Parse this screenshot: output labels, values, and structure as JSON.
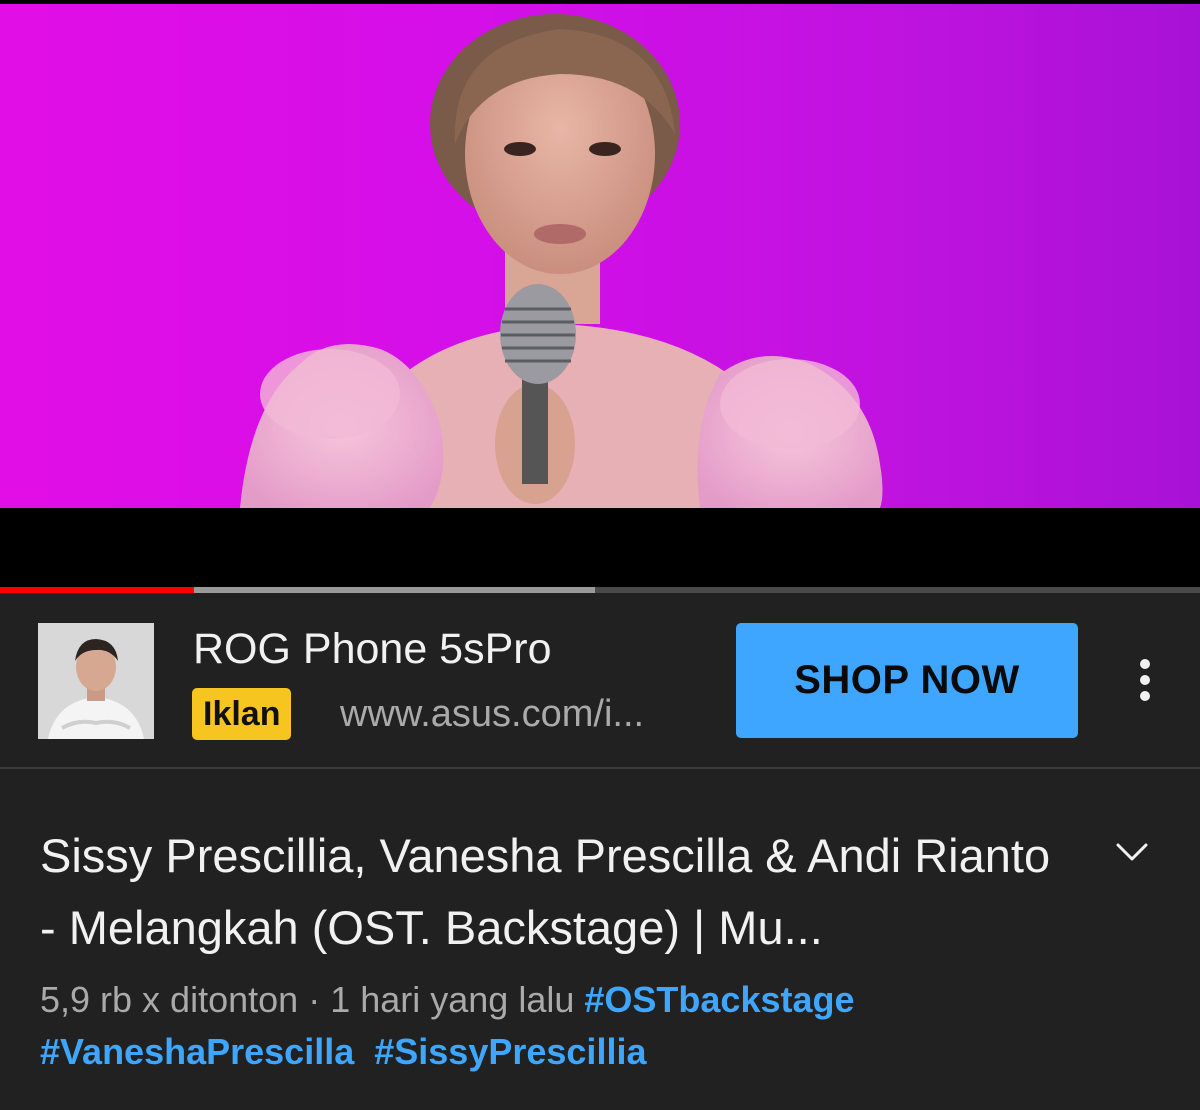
{
  "player": {
    "progress_played": 0.162,
    "progress_buffered": 0.496,
    "colors": {
      "played": "#ff0000",
      "buffered": "#9a9a9a",
      "track": "#4a4a4a"
    }
  },
  "ad": {
    "title": "ROG Phone 5sPro",
    "badge": "Iklan",
    "url": "www.asus.com/i...",
    "cta_label": "SHOP NOW",
    "more_icon": "more-vert-icon",
    "colors": {
      "badge": "#f7c520",
      "cta": "#3ea6ff"
    }
  },
  "video": {
    "title": "Sissy Prescillia, Vanesha Prescilla & Andi Rianto - Melangkah (OST. Backstage) | Mu...",
    "views": "5,9 rb x ditonton",
    "separator": "·",
    "time_ago": "1 hari yang lalu",
    "hashtags": [
      "#OSTbackstage",
      "#VaneshaPrescilla",
      "#SissyPrescillia"
    ],
    "expand_icon": "chevron-down-icon",
    "colors": {
      "hashtag": "#3ea6ff"
    }
  }
}
